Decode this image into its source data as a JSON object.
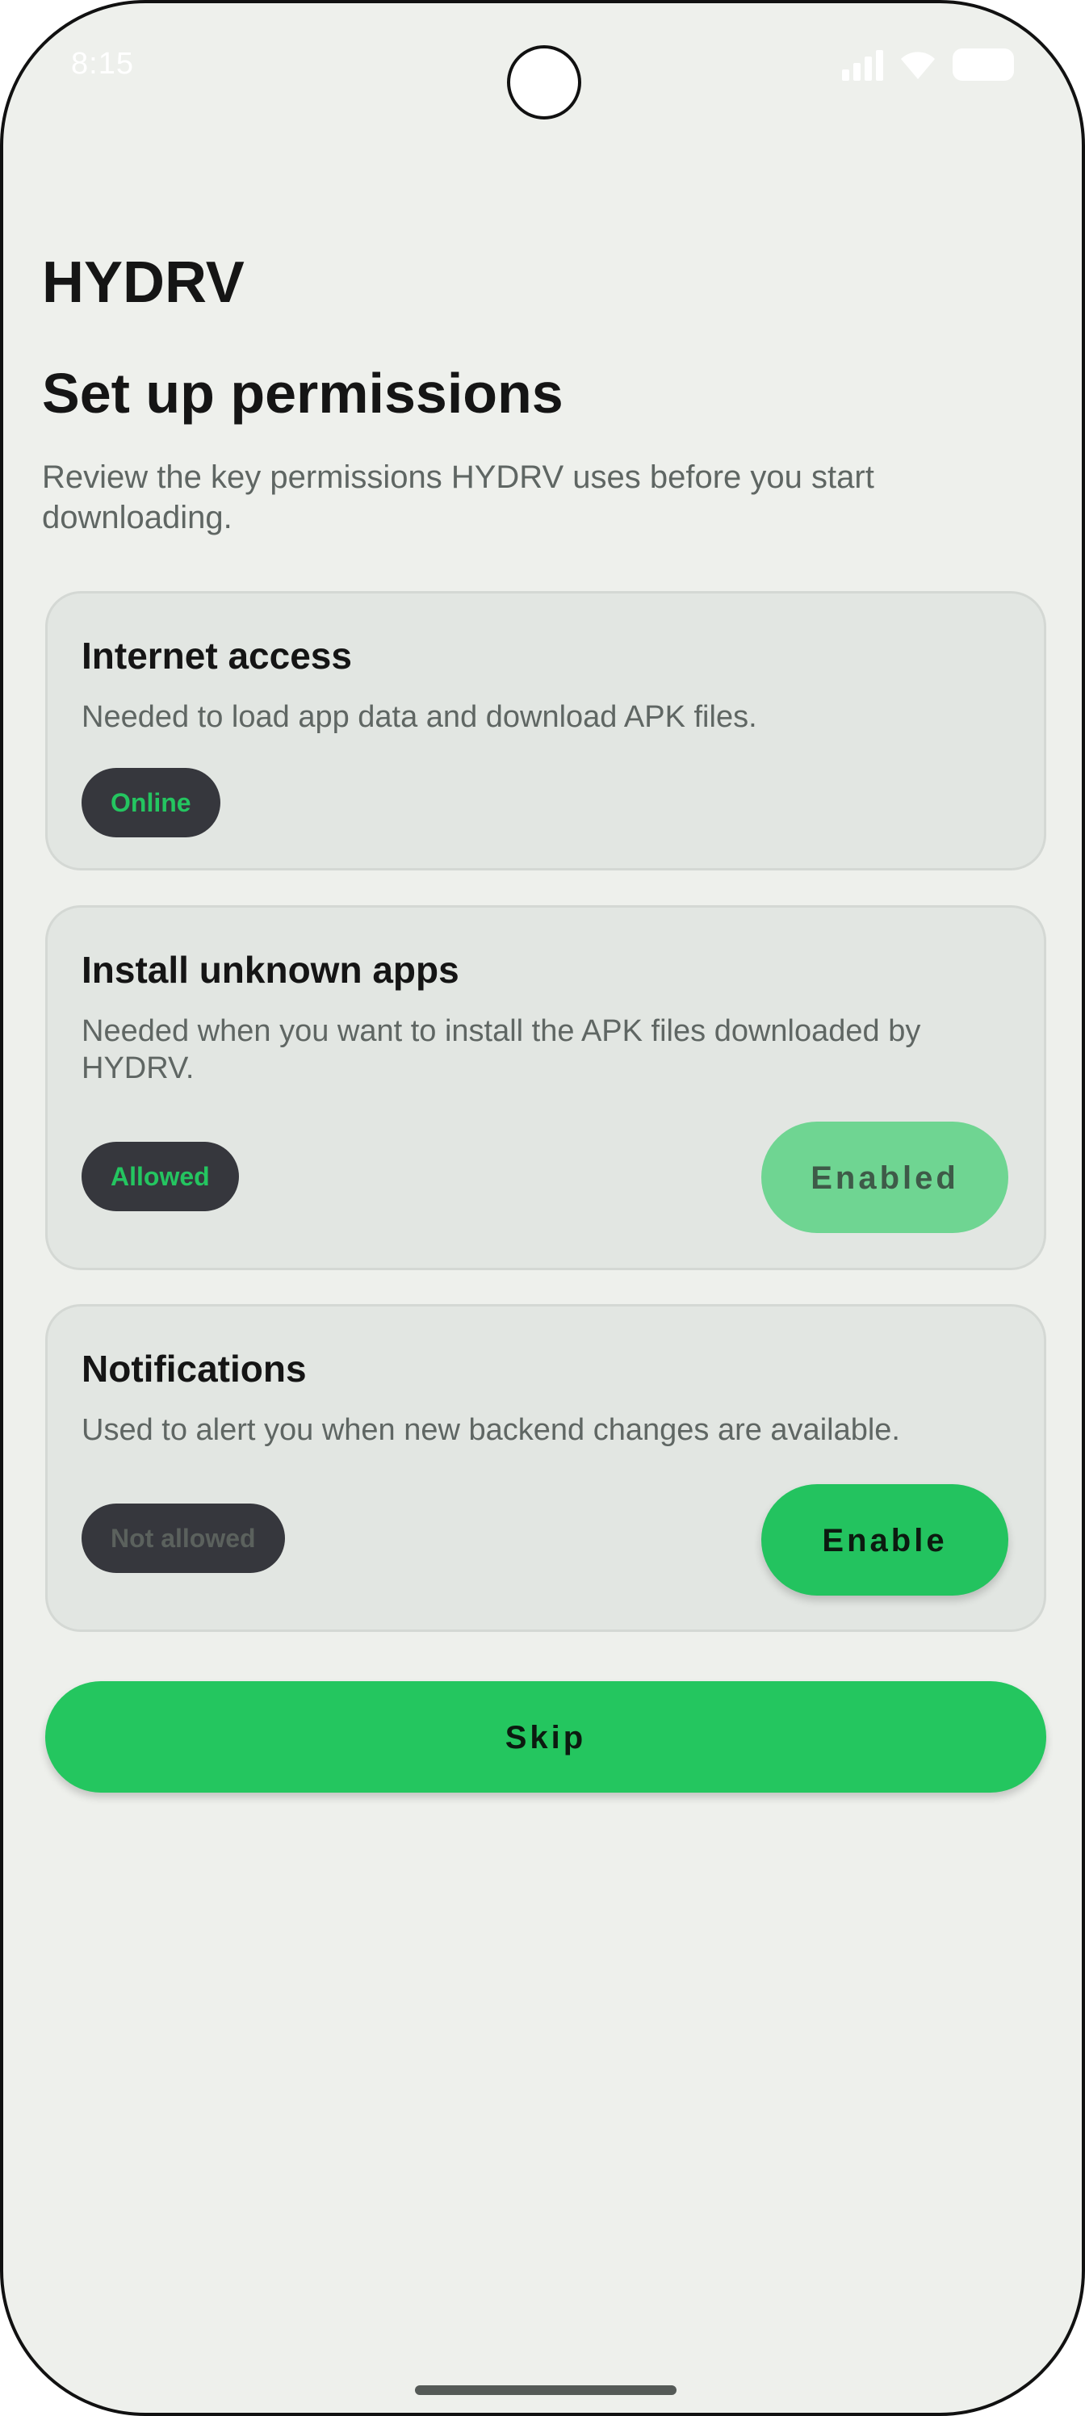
{
  "status_bar": {
    "time": "8:15",
    "icons": [
      "signal-icon",
      "wifi-icon",
      "battery-icon"
    ]
  },
  "header": {
    "app_name": "HYDRV",
    "title": "Set up permissions",
    "subtitle": "Review the key permissions HYDRV uses before you start downloading."
  },
  "permissions": [
    {
      "title": "Internet access",
      "description": "Needed to load app data and download APK files.",
      "status": "Online"
    },
    {
      "title": "Install unknown apps",
      "description": "Needed when you want to install the APK files downloaded by HYDRV.",
      "status": "Allowed",
      "action_label": "Enabled"
    },
    {
      "title": "Notifications",
      "description": "Used to alert you when new backend changes are available.",
      "status": "Not allowed",
      "action_label": "Enable"
    }
  ],
  "skip_label": "Skip",
  "colors": {
    "accent": "#23c35f",
    "background": "#eef0ec",
    "card": "#e2e6e2",
    "chip": "#36373d"
  }
}
